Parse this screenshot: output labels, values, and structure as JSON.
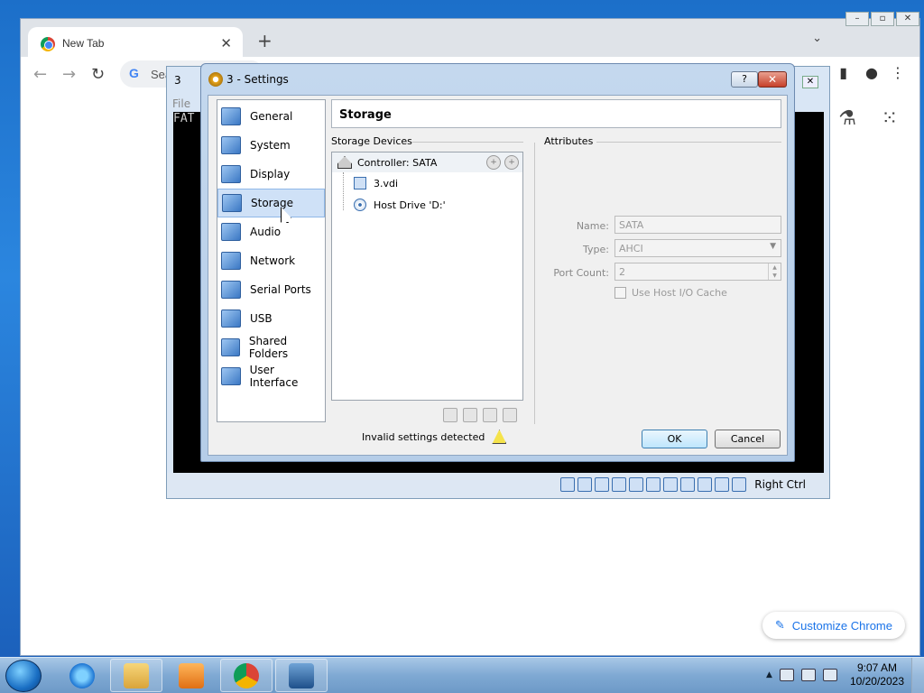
{
  "chrome": {
    "tab_title": "New Tab",
    "tab_close": "✕",
    "new_tab": "+",
    "tab_menu": "⌄",
    "omnibox_g": "G",
    "omnibox_text": "Sea",
    "back": "←",
    "forward": "→",
    "reload": "↻",
    "customize_label": "Customize Chrome",
    "customize_icon": "✎"
  },
  "vm": {
    "title_icon": "3",
    "menu_text": "File",
    "console_text": "FAT",
    "host_key": "Right Ctrl",
    "close": "✕"
  },
  "dialog": {
    "title": "3 - Settings",
    "help": "?",
    "close": "✕",
    "sidebar": [
      {
        "label": "General",
        "icon": "general-icon"
      },
      {
        "label": "System",
        "icon": "system-icon"
      },
      {
        "label": "Display",
        "icon": "display-icon"
      },
      {
        "label": "Storage",
        "icon": "storage-icon",
        "selected": true
      },
      {
        "label": "Audio",
        "icon": "audio-icon"
      },
      {
        "label": "Network",
        "icon": "network-icon"
      },
      {
        "label": "Serial Ports",
        "icon": "serial-ports-icon"
      },
      {
        "label": "USB",
        "icon": "usb-icon"
      },
      {
        "label": "Shared Folders",
        "icon": "shared-folders-icon"
      },
      {
        "label": "User Interface",
        "icon": "user-interface-icon"
      }
    ],
    "header": "Storage",
    "storage_devices_label": "Storage Devices",
    "controller": "Controller: SATA",
    "devices": [
      "3.vdi",
      "Host Drive 'D:'"
    ],
    "attributes_label": "Attributes",
    "attr": {
      "name_label": "Name:",
      "name_value": "SATA",
      "type_label": "Type:",
      "type_value": "AHCI",
      "port_count_label": "Port Count:",
      "port_count_value": "2",
      "host_io_cache_label": "Use Host I/O Cache"
    },
    "invalid_text": "Invalid settings detected",
    "ok": "OK",
    "cancel": "Cancel"
  },
  "taskbar": {
    "time": "9:07 AM",
    "date": "10/20/2023"
  }
}
